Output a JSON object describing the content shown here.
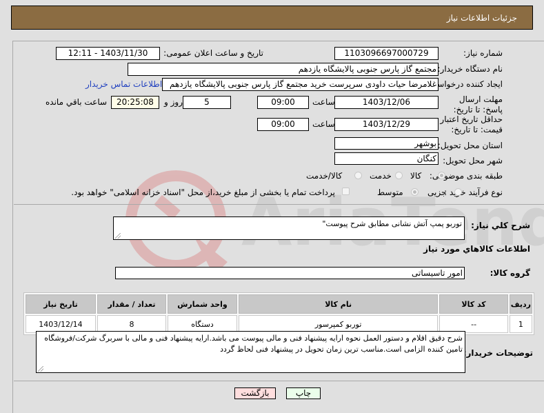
{
  "header": {
    "title": "جزئيات اطلاعات نياز"
  },
  "form": {
    "need_number_label": "شماره نیاز:",
    "need_number": "1103096697000729",
    "announce_label": "تاریخ و ساعت اعلان عمومی:",
    "announce_value": "1403/11/30 - 12:11",
    "buyer_org_label": "نام دستگاه خریدار:",
    "buyer_org": "مجتمع گاز پارس جنوبی  پالایشگاه یازدهم",
    "creator_label": "ایجاد کننده درخواست:",
    "creator": "غلامرضا حیات داودی سرپرست خرید مجتمع گاز پارس جنوبی  پالایشگاه یازدهم",
    "contact_link": "اطلاعات تماس خریدار",
    "reply_deadline_label": "مهلت ارسال پاسخ: تا تاریخ:",
    "reply_date": "1403/12/06",
    "time_label": "ساعت",
    "reply_time": "09:00",
    "days_remaining": "5",
    "days_label": "روز و",
    "time_remaining": "20:25:08",
    "time_remaining_label": "ساعت باقي مانده",
    "price_validity_label": "حداقل تاریخ اعتبار قیمت: تا تاریخ:",
    "price_date": "1403/12/29",
    "price_time": "09:00",
    "province_label": "استان محل تحویل:",
    "province": "بوشهر",
    "city_label": "شهر محل تحویل:",
    "city": "کنگان",
    "category_label": "طبقه بندی موضوعی:",
    "category_options": [
      "کالا",
      "خدمت",
      "کالا/خدمت"
    ],
    "category_selected": "کالا",
    "process_label": "نوع فرآیند خرید :",
    "process_options": [
      "جزیی",
      "متوسط"
    ],
    "process_selected": "متوسط",
    "payment_note": "پرداخت تمام یا بخشی از مبلغ خرید،از محل \"اسناد خزانه اسلامی\" خواهد بود.",
    "general_desc_label": "شرح کلي نياز:",
    "general_desc": "توربو پمپ آتش نشانی مطابق شرح پیوست\"",
    "items_section_title": "اطلاعات کالاهاي مورد نياز",
    "goods_group_label": "گروه کالا:",
    "goods_group": "امور تاسیساتی"
  },
  "table": {
    "headers": [
      "ردیف",
      "کد کالا",
      "نام کالا",
      "واحد شمارش",
      "تعداد / مقدار",
      "تاریخ نیاز"
    ],
    "rows": [
      [
        "1",
        "--",
        "توربو کمپرسور",
        "دستگاه",
        "8",
        "1403/12/14"
      ]
    ]
  },
  "buyer_notes": {
    "label": "توضیحات خریدار:",
    "text": "شرح دقیق اقلام و دستور العمل نحوه ارایه پیشنهاد فنی و مالی پیوست می باشد.ارایه پیشنهاد فنی و مالی با سربرگ شرکت/فروشگاه تامین کننده الزامی است.مناسب ترین زمان تحویل در پیشنهاد فنی لحاظ گردد"
  },
  "buttons": {
    "print": "چاپ",
    "back": "بازگشت"
  },
  "colors": {
    "header_bg": "#8b6c42",
    "link": "#1f3fbf",
    "print_bg": "#eaffea",
    "back_bg": "#ffdede",
    "countdown_bg": "#fffde8"
  }
}
